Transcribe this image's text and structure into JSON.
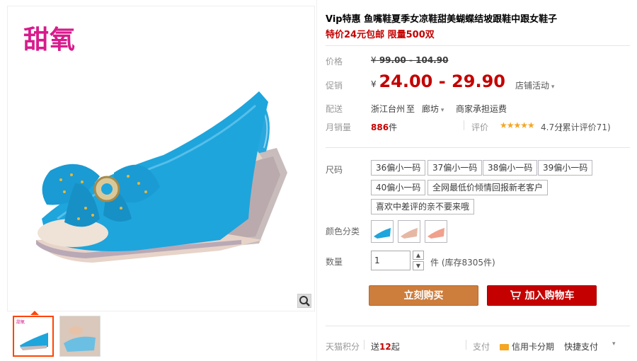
{
  "gallery": {
    "logo": "甜氧",
    "zoom_icon": "magnifier-icon"
  },
  "product": {
    "title": "Vip特惠 鱼嘴鞋夏季女凉鞋甜美蝴蝶结坡跟鞋中跟女鞋子",
    "promo": "特价24元包邮 限量500双"
  },
  "price": {
    "label": "价格",
    "currency": "¥",
    "original": "99.00 - 104.90",
    "promo_label": "促销",
    "promo": "24.00 - 29.90",
    "store_activity": "店铺活动"
  },
  "shipping": {
    "label": "配送",
    "from": "浙江台州",
    "to_word": "至",
    "to": "廊坊",
    "fee": "商家承担运费"
  },
  "sales": {
    "label": "月销量",
    "count": "886",
    "unit": "件",
    "rating_label": "评价",
    "stars": "★★★★★",
    "score": "4.7分",
    "total": "(累计评价71)"
  },
  "sizes": {
    "label": "尺码",
    "options": [
      "36偏小一码",
      "37偏小一码",
      "38偏小一码",
      "39偏小一码",
      "40偏小一码",
      "全网最低价倾情回报新老客户",
      "喜欢中差评的亲不要来哦"
    ]
  },
  "colors": {
    "label": "颜色分类"
  },
  "quantity": {
    "label": "数量",
    "value": "1",
    "stock": "件 (库存8305件)"
  },
  "buttons": {
    "buy": "立刻购买",
    "cart": "加入购物车"
  },
  "footer": {
    "points_label": "天猫积分",
    "points_pre": "送",
    "points": "12",
    "points_post": "起",
    "pay_label": "支付",
    "credit": "信用卡分期",
    "quick": "快捷支付"
  },
  "theme": {
    "accent": "#c40000",
    "buy_color": "#cd7d3c",
    "logo_color": "#d81b8c"
  }
}
